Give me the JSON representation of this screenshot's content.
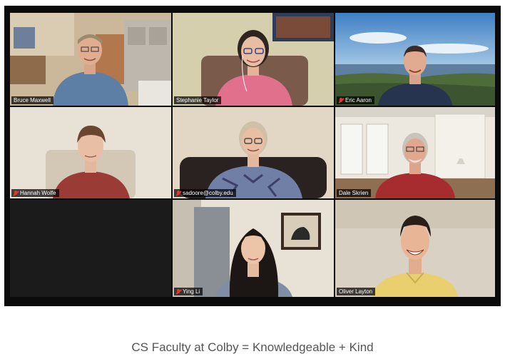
{
  "meeting": {
    "participants": [
      {
        "name": "Bruce Maxwell",
        "muted": true
      },
      {
        "name": "Stephanie Taylor",
        "muted": false
      },
      {
        "name": "Eric Aaron",
        "muted": true
      },
      {
        "name": "Hannah Wolfe",
        "muted": true
      },
      {
        "name": "sadoore@colby.edu",
        "muted": true
      },
      {
        "name": "Dale Skrien",
        "muted": false
      },
      {
        "name": "",
        "muted": false
      },
      {
        "name": "Ying Li",
        "muted": true
      },
      {
        "name": "Oliver Layton",
        "muted": false
      }
    ]
  },
  "caption": "CS Faculty at Colby = Knowledgeable + Kind",
  "colors": {
    "mic_muted": "#e03a2f",
    "frame": "#0b0b0b",
    "caption_text": "#555555"
  }
}
